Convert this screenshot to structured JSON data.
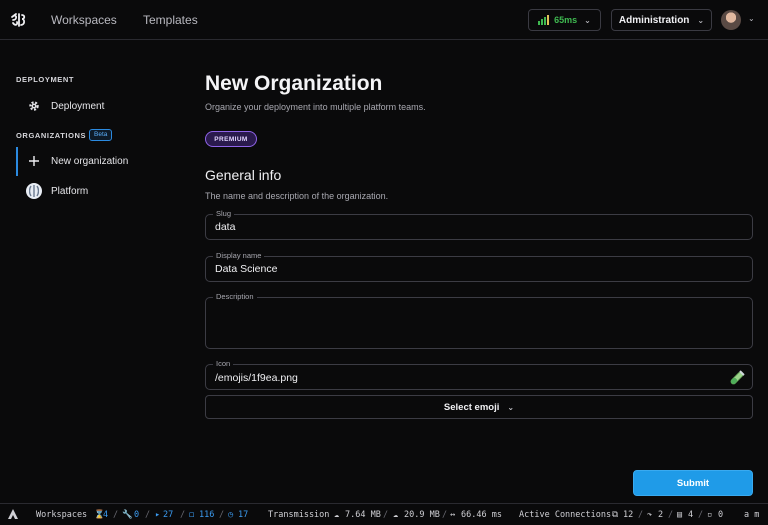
{
  "navbar": {
    "links": [
      "Workspaces",
      "Templates"
    ],
    "latency": "65ms",
    "admin_label": "Administration"
  },
  "sidebar": {
    "deployment_heading": "DEPLOYMENT",
    "deployment_item": "Deployment",
    "orgs_heading": "ORGANIZATIONS",
    "beta_badge": "Beta",
    "new_org_item": "New organization",
    "platform_item": "Platform"
  },
  "main": {
    "title": "New Organization",
    "subtitle": "Organize your deployment into multiple platform teams.",
    "premium_badge": "PREMIUM",
    "section_title": "General info",
    "section_desc": "The name and description of the organization.",
    "fields": {
      "slug": {
        "label": "Slug",
        "value": "data"
      },
      "display_name": {
        "label": "Display name",
        "value": "Data Science"
      },
      "description": {
        "label": "Description",
        "value": ""
      },
      "icon": {
        "label": "Icon",
        "value": "/emojis/1f9ea.png"
      }
    },
    "select_emoji_label": "Select emoji",
    "submit_label": "Submit"
  },
  "statusbar": {
    "workspaces_label": "Workspaces",
    "workspaces_counts": [
      "4",
      "0",
      "27",
      "116",
      "17"
    ],
    "transmission_label": "Transmission",
    "tx_up": "7.64 MB",
    "tx_down": "20.9 MB",
    "latency": "66.46 ms",
    "connections_label": "Active Connections",
    "connections_counts": [
      "12",
      "2",
      "4",
      "0"
    ],
    "trailing": "a m"
  },
  "colors": {
    "accent": "#1f9be8",
    "premium": "#8f63e8",
    "latency_good": "#3fb950",
    "background": "#0a0a0b"
  }
}
